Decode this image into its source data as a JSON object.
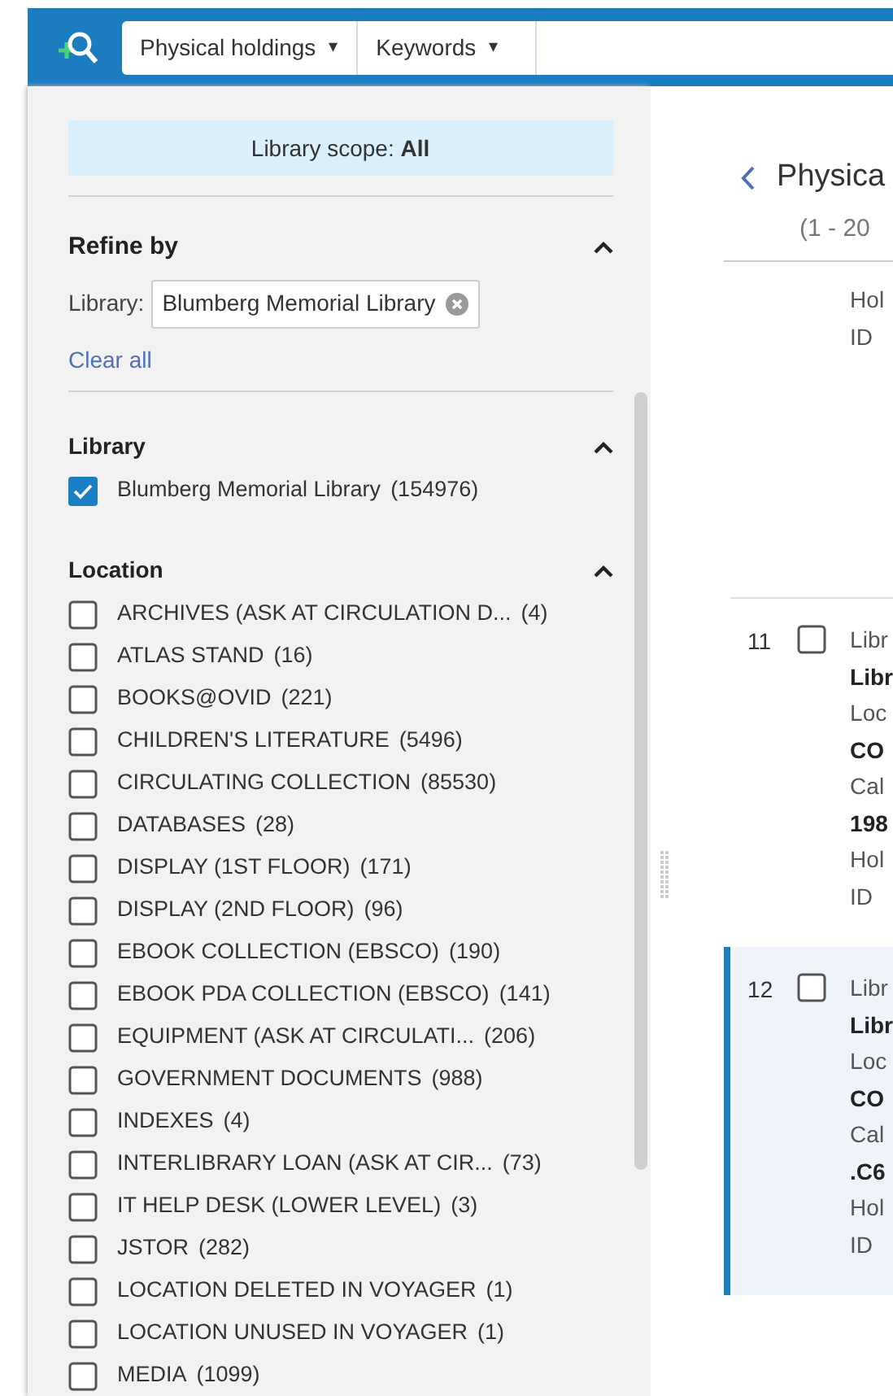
{
  "search_bar": {
    "scope_dropdown": "Physical holdings",
    "caret": "▾",
    "field_dropdown": "Keywords",
    "field_caret": "▾"
  },
  "sidebar": {
    "scope_label": "Library scope:",
    "scope_value": "All",
    "refine": {
      "title": "Refine by",
      "expanded": true,
      "filter_label": "Library:",
      "filter_value": "Blumberg Memorial Library",
      "clear_all": "Clear all"
    },
    "facets": [
      {
        "title": "Library",
        "expanded": true,
        "items": [
          {
            "label": "Blumberg Memorial Library",
            "count": "(154976)",
            "checked": true
          }
        ]
      },
      {
        "title": "Location",
        "expanded": true,
        "items": [
          {
            "label": "ARCHIVES (ASK AT CIRCULATION D...",
            "count": "(4)",
            "checked": false
          },
          {
            "label": "ATLAS STAND",
            "count": "(16)",
            "checked": false
          },
          {
            "label": "BOOKS@OVID",
            "count": "(221)",
            "checked": false
          },
          {
            "label": "CHILDREN'S LITERATURE",
            "count": "(5496)",
            "checked": false
          },
          {
            "label": "CIRCULATING COLLECTION",
            "count": "(85530)",
            "checked": false
          },
          {
            "label": "DATABASES",
            "count": "(28)",
            "checked": false
          },
          {
            "label": "DISPLAY (1ST FLOOR)",
            "count": "(171)",
            "checked": false
          },
          {
            "label": "DISPLAY (2ND FLOOR)",
            "count": "(96)",
            "checked": false
          },
          {
            "label": "EBOOK COLLECTION (EBSCO)",
            "count": "(190)",
            "checked": false
          },
          {
            "label": "EBOOK PDA COLLECTION (EBSCO)",
            "count": "(141)",
            "checked": false
          },
          {
            "label": "EQUIPMENT (ASK AT CIRCULATI...",
            "count": "(206)",
            "checked": false
          },
          {
            "label": "GOVERNMENT DOCUMENTS",
            "count": "(988)",
            "checked": false
          },
          {
            "label": "INDEXES",
            "count": "(4)",
            "checked": false
          },
          {
            "label": "INTERLIBRARY LOAN (ASK AT CIR...",
            "count": "(73)",
            "checked": false
          },
          {
            "label": "IT HELP DESK (LOWER LEVEL)",
            "count": "(3)",
            "checked": false
          },
          {
            "label": "JSTOR",
            "count": "(282)",
            "checked": false
          },
          {
            "label": "LOCATION DELETED IN VOYAGER",
            "count": "(1)",
            "checked": false
          },
          {
            "label": "LOCATION UNUSED IN VOYAGER",
            "count": "(1)",
            "checked": false
          },
          {
            "label": "MEDIA",
            "count": "(1099)",
            "checked": false
          }
        ]
      }
    ]
  },
  "results": {
    "title": "Physica",
    "range": "(1 - 20",
    "rows": [
      {
        "number": "",
        "selected": false,
        "lines": [
          {
            "text": "Hol",
            "bold": false
          },
          {
            "text": "ID",
            "bold": false
          }
        ]
      },
      {
        "number": "11",
        "selected": false,
        "checked": false,
        "lines": [
          {
            "text": "Libr",
            "bold": false
          },
          {
            "text": "Libr",
            "bold": true
          },
          {
            "text": "Loc",
            "bold": false
          },
          {
            "text": "CO",
            "bold": true
          },
          {
            "text": "Cal",
            "bold": false
          },
          {
            "text": "198",
            "bold": true
          },
          {
            "text": "Hol",
            "bold": false
          },
          {
            "text": "ID",
            "bold": false
          }
        ]
      },
      {
        "number": "12",
        "selected": true,
        "checked": false,
        "lines": [
          {
            "text": "Libr",
            "bold": false
          },
          {
            "text": "Libr",
            "bold": true
          },
          {
            "text": "Loc",
            "bold": false
          },
          {
            "text": "CO",
            "bold": true
          },
          {
            "text": "Cal",
            "bold": false
          },
          {
            "text": ".C6",
            "bold": true
          },
          {
            "text": "Hol",
            "bold": false
          },
          {
            "text": "ID",
            "bold": false
          }
        ]
      }
    ]
  }
}
